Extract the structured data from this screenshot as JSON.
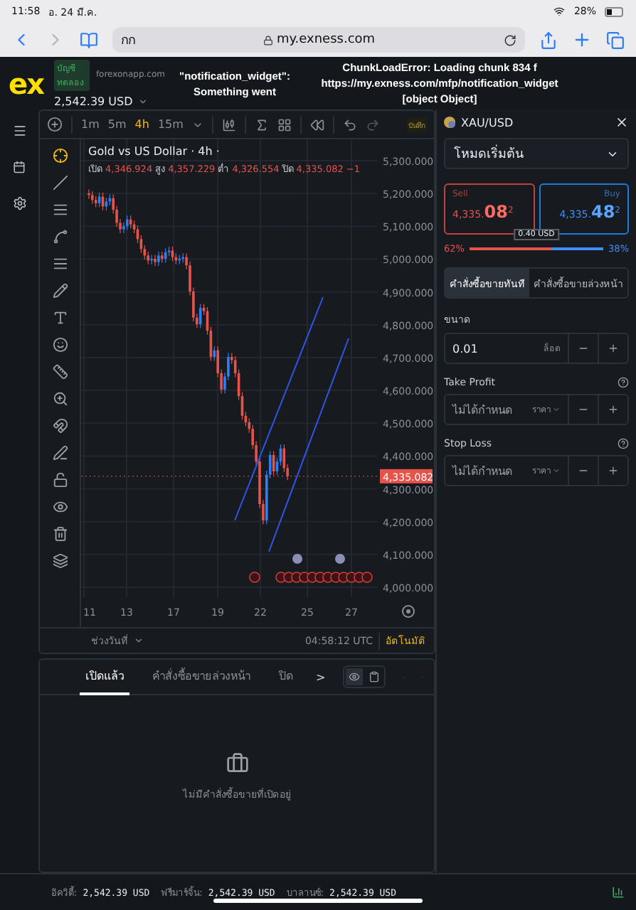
{
  "status_bar": {
    "time": "11:58",
    "date": "อ. 24 มี.ค.",
    "battery": "28%"
  },
  "browser": {
    "tab_text": "กก",
    "url": "my.exness.com"
  },
  "header": {
    "logo": "ex",
    "account_badge": "บัญชีทดลอง",
    "domain": "forexonapp.com",
    "balance": "2,542.39 USD",
    "errors": [
      {
        "lines": [
          "\"notification_widget\":",
          "Something went"
        ]
      },
      {
        "lines": [
          "ChunkLoadError: Loading chunk 834 f",
          "https://my.exness.com/mfp/notification_widget",
          "[object Object]"
        ]
      }
    ]
  },
  "chart": {
    "intervals": [
      {
        "label": "1m",
        "selected": false
      },
      {
        "label": "5m",
        "selected": false
      },
      {
        "label": "4h",
        "selected": true
      },
      {
        "label": "15m",
        "selected": false
      }
    ],
    "save_label": "บันทึก",
    "title": "Gold vs US Dollar · 4h ·",
    "ohlc": [
      {
        "label": "เปิด",
        "value": "4,346.924"
      },
      {
        "label": "สูง",
        "value": "4,357.229"
      },
      {
        "label": "ต่ำ",
        "value": "4,326.554"
      },
      {
        "label": "ปิด",
        "value": "4,335.082"
      }
    ],
    "change": "−1",
    "price_labels": [
      "5,300.000",
      "5,200.000",
      "5,100.000",
      "5,000.000",
      "4,900.000",
      "4,800.000",
      "4,700.000",
      "4,600.000",
      "4,500.000",
      "4,400.000",
      "4,300.000",
      "4,200.000",
      "4,100.000",
      "4,000.000"
    ],
    "date_labels": [
      "11",
      "13",
      "17",
      "19",
      "22",
      "25",
      "27"
    ],
    "last_price": "4,335.082",
    "range": "ช่วงวันที่",
    "clock": "04:58:12 UTC",
    "auto": "อัตโนมัติ"
  },
  "order_panel": {
    "symbol": "XAU/USD",
    "mode": "โหมดเริ่มต้น",
    "sell": {
      "label": "Sell",
      "main": "4,335.",
      "big": "08",
      "pip": "2"
    },
    "buy": {
      "label": "Buy",
      "main": "4,335.",
      "big": "48",
      "pip": "2"
    },
    "spread": "0.40 USD",
    "sell_share": "62%",
    "buy_share": "38%",
    "level": 0.62,
    "tabs": [
      {
        "label": "คำสั่งซื้อขายทันที",
        "selected": true
      },
      {
        "label": "คำสั่งซื้อขายล่วงหน้า",
        "selected": false
      }
    ],
    "fields": [
      {
        "label": "ขนาด",
        "value": "0.01",
        "unit": "ล็อต",
        "kind": "volume"
      },
      {
        "label": "Take Profit",
        "value": "ไม่ได้กำหนด",
        "unit": "ราคา",
        "kind": "price"
      },
      {
        "label": "Stop Loss",
        "value": "ไม่ได้กำหนด",
        "unit": "ราคา",
        "kind": "price"
      }
    ]
  },
  "positions": {
    "tabs": [
      {
        "label": "เปิดแล้ว",
        "selected": true
      },
      {
        "label": "คำสั่งซื้อขายล่วงหน้า",
        "selected": false
      },
      {
        "label": "ปิด",
        "selected": false
      }
    ],
    "more": ">",
    "empty_text": "ไม่มีคำสั่งซื้อขายที่เปิดอยู่"
  },
  "footer": [
    {
      "label": "อิควิตี้:",
      "value": "2,542.39 USD"
    },
    {
      "label": "ฟรีมาร์จิ้น:",
      "value": "2,542.39 USD"
    },
    {
      "label": "บาลานซ์:",
      "value": "2,542.39 USD"
    }
  ]
}
